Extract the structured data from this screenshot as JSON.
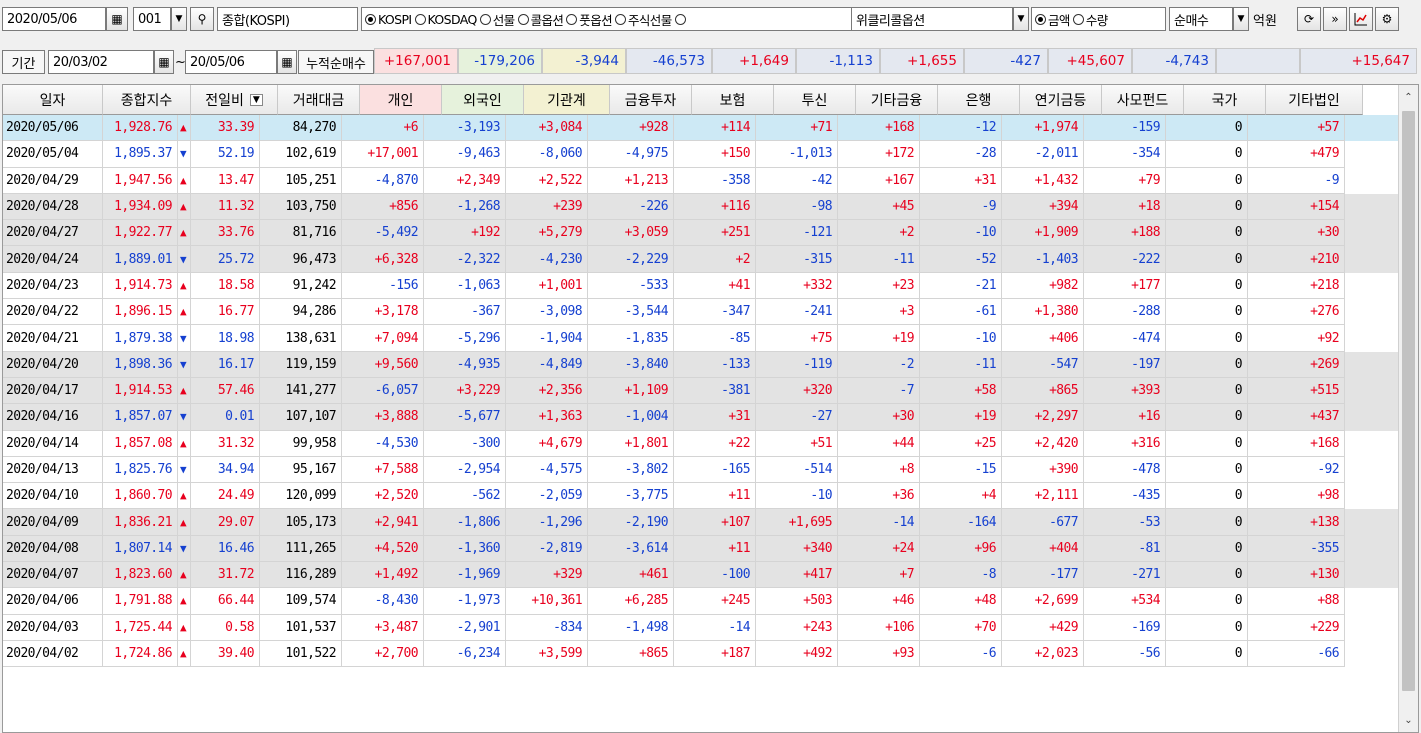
{
  "toolbar": {
    "date": "2020/05/06",
    "code": "001",
    "index_name": "종합(KOSPI)",
    "market_options": [
      {
        "label": "KOSPI",
        "selected": true
      },
      {
        "label": "KOSDAQ",
        "selected": false
      },
      {
        "label": "선물",
        "selected": false
      },
      {
        "label": "콜옵션",
        "selected": false
      },
      {
        "label": "풋옵션",
        "selected": false
      },
      {
        "label": "주식선물",
        "selected": false
      },
      {
        "label": "",
        "selected": false
      }
    ],
    "weekly_option": "위클리콜옵션",
    "unit_options": [
      {
        "label": "금액",
        "selected": true
      },
      {
        "label": "수량",
        "selected": false
      }
    ],
    "net_mode": "순매수",
    "unit_label": "억원"
  },
  "period": {
    "label": "기간",
    "start": "20/03/02",
    "separator": "~",
    "end": "20/05/06",
    "cumulative_label": "누적순매수"
  },
  "summary": [
    "+167,001",
    "-179,206",
    "-3,944",
    "-46,573",
    "+1,649",
    "-1,113",
    "+1,655",
    "-427",
    "+45,607",
    "-4,743",
    "",
    "+15,647"
  ],
  "columns": [
    "일자",
    "종합지수",
    "전일비",
    "거래대금",
    "개인",
    "외국인",
    "기관계",
    "금융투자",
    "보험",
    "투신",
    "기타금융",
    "은행",
    "연기금등",
    "사모펀드",
    "국가",
    "기타법인"
  ],
  "rows": [
    [
      "2020/05/06",
      "1,928.76",
      "up",
      "33.39",
      "84,270",
      "+6",
      "-3,193",
      "+3,084",
      "+928",
      "+114",
      "+71",
      "+168",
      "-12",
      "+1,974",
      "-159",
      "0",
      "+57"
    ],
    [
      "2020/05/04",
      "1,895.37",
      "down",
      "52.19",
      "102,619",
      "+17,001",
      "-9,463",
      "-8,060",
      "-4,975",
      "+150",
      "-1,013",
      "+172",
      "-28",
      "-2,011",
      "-354",
      "0",
      "+479"
    ],
    [
      "2020/04/29",
      "1,947.56",
      "up",
      "13.47",
      "105,251",
      "-4,870",
      "+2,349",
      "+2,522",
      "+1,213",
      "-358",
      "-42",
      "+167",
      "+31",
      "+1,432",
      "+79",
      "0",
      "-9"
    ],
    [
      "2020/04/28",
      "1,934.09",
      "up",
      "11.32",
      "103,750",
      "+856",
      "-1,268",
      "+239",
      "-226",
      "+116",
      "-98",
      "+45",
      "-9",
      "+394",
      "+18",
      "0",
      "+154"
    ],
    [
      "2020/04/27",
      "1,922.77",
      "up",
      "33.76",
      "81,716",
      "-5,492",
      "+192",
      "+5,279",
      "+3,059",
      "+251",
      "-121",
      "+2",
      "-10",
      "+1,909",
      "+188",
      "0",
      "+30"
    ],
    [
      "2020/04/24",
      "1,889.01",
      "down",
      "25.72",
      "96,473",
      "+6,328",
      "-2,322",
      "-4,230",
      "-2,229",
      "+2",
      "-315",
      "-11",
      "-52",
      "-1,403",
      "-222",
      "0",
      "+210"
    ],
    [
      "2020/04/23",
      "1,914.73",
      "up",
      "18.58",
      "91,242",
      "-156",
      "-1,063",
      "+1,001",
      "-533",
      "+41",
      "+332",
      "+23",
      "-21",
      "+982",
      "+177",
      "0",
      "+218"
    ],
    [
      "2020/04/22",
      "1,896.15",
      "up",
      "16.77",
      "94,286",
      "+3,178",
      "-367",
      "-3,098",
      "-3,544",
      "-347",
      "-241",
      "+3",
      "-61",
      "+1,380",
      "-288",
      "0",
      "+276"
    ],
    [
      "2020/04/21",
      "1,879.38",
      "down",
      "18.98",
      "138,631",
      "+7,094",
      "-5,296",
      "-1,904",
      "-1,835",
      "-85",
      "+75",
      "+19",
      "-10",
      "+406",
      "-474",
      "0",
      "+92"
    ],
    [
      "2020/04/20",
      "1,898.36",
      "down",
      "16.17",
      "119,159",
      "+9,560",
      "-4,935",
      "-4,849",
      "-3,840",
      "-133",
      "-119",
      "-2",
      "-11",
      "-547",
      "-197",
      "0",
      "+269"
    ],
    [
      "2020/04/17",
      "1,914.53",
      "up",
      "57.46",
      "141,277",
      "-6,057",
      "+3,229",
      "+2,356",
      "+1,109",
      "-381",
      "+320",
      "-7",
      "+58",
      "+865",
      "+393",
      "0",
      "+515"
    ],
    [
      "2020/04/16",
      "1,857.07",
      "down",
      "0.01",
      "107,107",
      "+3,888",
      "-5,677",
      "+1,363",
      "-1,004",
      "+31",
      "-27",
      "+30",
      "+19",
      "+2,297",
      "+16",
      "0",
      "+437"
    ],
    [
      "2020/04/14",
      "1,857.08",
      "up",
      "31.32",
      "99,958",
      "-4,530",
      "-300",
      "+4,679",
      "+1,801",
      "+22",
      "+51",
      "+44",
      "+25",
      "+2,420",
      "+316",
      "0",
      "+168"
    ],
    [
      "2020/04/13",
      "1,825.76",
      "down",
      "34.94",
      "95,167",
      "+7,588",
      "-2,954",
      "-4,575",
      "-3,802",
      "-165",
      "-514",
      "+8",
      "-15",
      "+390",
      "-478",
      "0",
      "-92"
    ],
    [
      "2020/04/10",
      "1,860.70",
      "up",
      "24.49",
      "120,099",
      "+2,520",
      "-562",
      "-2,059",
      "-3,775",
      "+11",
      "-10",
      "+36",
      "+4",
      "+2,111",
      "-435",
      "0",
      "+98"
    ],
    [
      "2020/04/09",
      "1,836.21",
      "up",
      "29.07",
      "105,173",
      "+2,941",
      "-1,806",
      "-1,296",
      "-2,190",
      "+107",
      "+1,695",
      "-14",
      "-164",
      "-677",
      "-53",
      "0",
      "+138"
    ],
    [
      "2020/04/08",
      "1,807.14",
      "down",
      "16.46",
      "111,265",
      "+4,520",
      "-1,360",
      "-2,819",
      "-3,614",
      "+11",
      "+340",
      "+24",
      "+96",
      "+404",
      "-81",
      "0",
      "-355"
    ],
    [
      "2020/04/07",
      "1,823.60",
      "up",
      "31.72",
      "116,289",
      "+1,492",
      "-1,969",
      "+329",
      "+461",
      "-100",
      "+417",
      "+7",
      "-8",
      "-177",
      "-271",
      "0",
      "+130"
    ],
    [
      "2020/04/06",
      "1,791.88",
      "up",
      "66.44",
      "109,574",
      "-8,430",
      "-1,973",
      "+10,361",
      "+6,285",
      "+245",
      "+503",
      "+46",
      "+48",
      "+2,699",
      "+534",
      "0",
      "+88"
    ],
    [
      "2020/04/03",
      "1,725.44",
      "up",
      "0.58",
      "101,537",
      "+3,487",
      "-2,901",
      "-834",
      "-1,498",
      "-14",
      "+243",
      "+106",
      "+70",
      "+429",
      "-169",
      "0",
      "+229"
    ],
    [
      "2020/04/02",
      "1,724.86",
      "up",
      "39.40",
      "101,522",
      "+2,700",
      "-6,234",
      "+3,599",
      "+865",
      "+187",
      "+492",
      "+93",
      "-6",
      "+2,023",
      "-56",
      "0",
      "-66"
    ]
  ],
  "colors": {
    "up": "#e8001e",
    "down": "#1540d0",
    "selected_row": "#cde9f5",
    "shaded_row": "#e3e3e3",
    "individual_header": "#fbe0e0",
    "foreign_header": "#e6f2dc",
    "institution_header": "#f3f1d2"
  }
}
